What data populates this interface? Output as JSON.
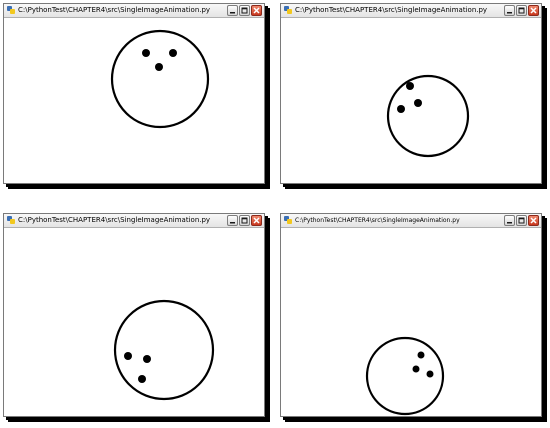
{
  "windows": [
    {
      "title": "C:\\PythonTest\\CHAPTER4\\src\\SingleImageAnimation.py",
      "controls": {
        "minimize": "minimize",
        "maximize": "maximize",
        "close": "close"
      },
      "content": "bowling-ball-image"
    },
    {
      "title": "C:\\PythonTest\\CHAPTER4\\src\\SingleImageAnimation.py",
      "controls": {
        "minimize": "minimize",
        "maximize": "maximize",
        "close": "close"
      },
      "content": "bowling-ball-image"
    },
    {
      "title": "C:\\PythonTest\\CHAPTER4\\src\\SingleImageAnimation.py",
      "controls": {
        "minimize": "minimize",
        "maximize": "maximize",
        "close": "close"
      },
      "content": "bowling-ball-image"
    },
    {
      "title": "C:\\PythonTest\\CHAPTER4\\src\\SingleImageAnimation.py",
      "controls": {
        "minimize": "minimize",
        "maximize": "maximize",
        "close": "close"
      },
      "content": "bowling-ball-image"
    }
  ],
  "colors": {
    "window_border": "#7a7a7a",
    "client_background": "#ffffff",
    "shadow": "#000000",
    "close_button": "#c9381f"
  },
  "icons": {
    "title_icon": "python-icon",
    "minimize": "minimize-icon",
    "maximize": "maximize-icon",
    "close": "close-icon"
  }
}
